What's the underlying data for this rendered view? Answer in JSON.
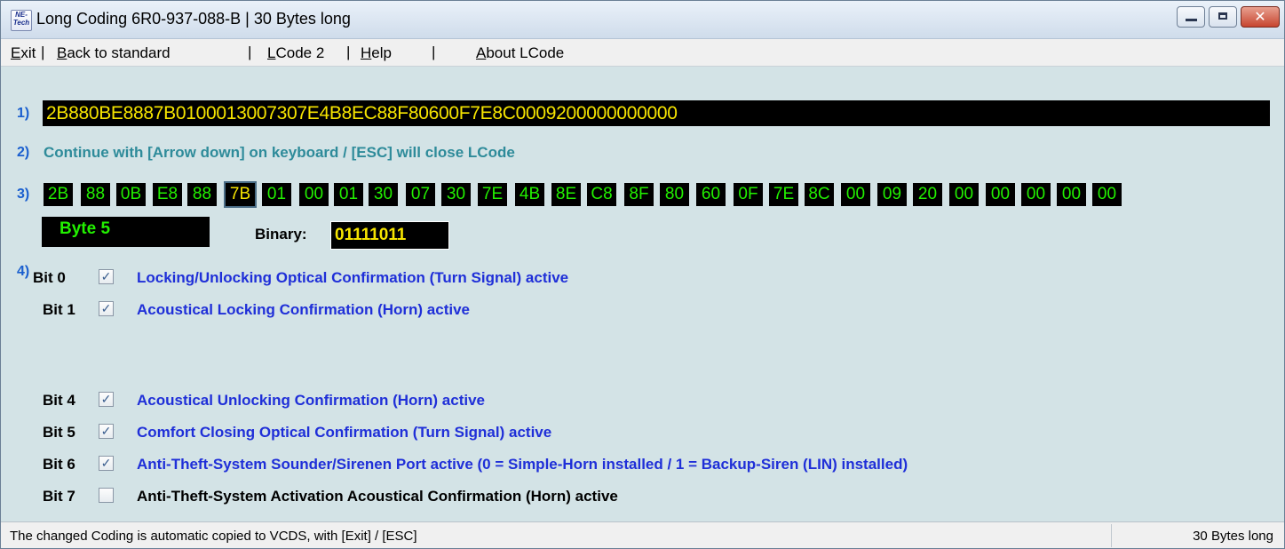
{
  "window": {
    "title": "Long Coding  6R0-937-088-B | 30 Bytes long",
    "icon_lines": [
      "NE-",
      "Tech"
    ],
    "controls": [
      "minimize-icon",
      "maximize-icon",
      "close-icon"
    ],
    "close_glyph": "✕"
  },
  "menu": [
    {
      "label": "Exit",
      "sep": "|"
    },
    {
      "label": "Back to standard",
      "sep": "|"
    },
    {
      "label": "LCode 2",
      "sep": "|"
    },
    {
      "label": "Help",
      "sep": "|"
    },
    {
      "label": "About LCode",
      "sep": ""
    }
  ],
  "step_labels": [
    "1)",
    "2)",
    "3)",
    "4)"
  ],
  "coding": "2B880BE8887B0100013007307E4B8EC88F80600F7E8C0009200000000000",
  "hint": "Continue with [Arrow down] on keyboard / [ESC] will close LCode",
  "bytes": [
    "2B",
    "88",
    "0B",
    "E8",
    "88",
    "7B",
    "01",
    "00",
    "01",
    "30",
    "07",
    "30",
    "7E",
    "4B",
    "8E",
    "C8",
    "8F",
    "80",
    "60",
    "0F",
    "7E",
    "8C",
    "00",
    "09",
    "20",
    "00",
    "00",
    "00",
    "00",
    "00"
  ],
  "selected_byte_index": 5,
  "byte_name": "Byte 5",
  "binary_label": "Binary:",
  "binary_value": "01111011",
  "bits": [
    {
      "label": "Bit 0",
      "checked": true,
      "text": "Locking/Unlocking Optical Confirmation (Turn Signal) active"
    },
    {
      "label": "Bit 1",
      "checked": true,
      "text": "Acoustical Locking Confirmation (Horn) active"
    },
    {
      "label": "Bit 4",
      "checked": true,
      "text": "Acoustical Unlocking Confirmation (Horn) active"
    },
    {
      "label": "Bit 5",
      "checked": true,
      "text": "Comfort Closing Optical Confirmation (Turn Signal) active"
    },
    {
      "label": "Bit 6",
      "checked": true,
      "text": "Anti-Theft-System Sounder/Sirenen Port active (0 = Simple-Horn installed / 1 = Backup-Siren (LIN) installed)"
    },
    {
      "label": "Bit 7",
      "checked": false,
      "text": "Anti-Theft-System Activation Acoustical Confirmation (Horn) active"
    }
  ],
  "check_glyph": "✓",
  "status": {
    "left": "The changed Coding is automatic copied to VCDS, with [Exit] / [ESC]",
    "right": "30 Bytes long"
  },
  "colors": {
    "enabled_text": "#1f2fd8",
    "disabled_text": "#000000",
    "byte_text": "#22f000",
    "selected_byte_text": "#f6e400",
    "step_number": "#1a5fcf"
  }
}
